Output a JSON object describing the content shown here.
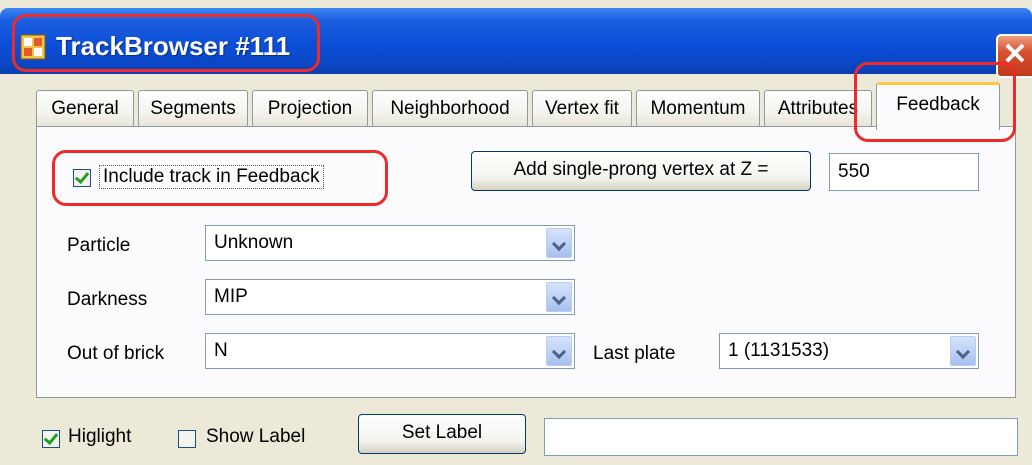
{
  "window": {
    "title": "TrackBrowser #111",
    "close_glyph": "✕"
  },
  "tabs": [
    {
      "label": "General"
    },
    {
      "label": "Segments"
    },
    {
      "label": "Projection"
    },
    {
      "label": "Neighborhood"
    },
    {
      "label": "Vertex fit"
    },
    {
      "label": "Momentum"
    },
    {
      "label": "Attributes"
    },
    {
      "label": "Feedback"
    }
  ],
  "feedback": {
    "include_label": "Include track in Feedback",
    "include_checked": true,
    "add_vertex_label": "Add single-prong vertex at Z =",
    "z_value": "550",
    "particle": {
      "label": "Particle",
      "value": "Unknown"
    },
    "darkness": {
      "label": "Darkness",
      "value": "MIP"
    },
    "out_of_brick": {
      "label": "Out of brick",
      "value": "N"
    },
    "last_plate": {
      "label": "Last plate",
      "value": "1 (1131533)"
    }
  },
  "bottom": {
    "highlight_label": "Higlight",
    "highlight_checked": true,
    "show_label_label": "Show Label",
    "show_label_checked": false,
    "set_label_button": "Set Label",
    "label_value": ""
  },
  "colors": {
    "titlebar": "#0b4fd8",
    "annotation": "#ee2a2a",
    "active_tab_accent": "#ffc73c"
  }
}
